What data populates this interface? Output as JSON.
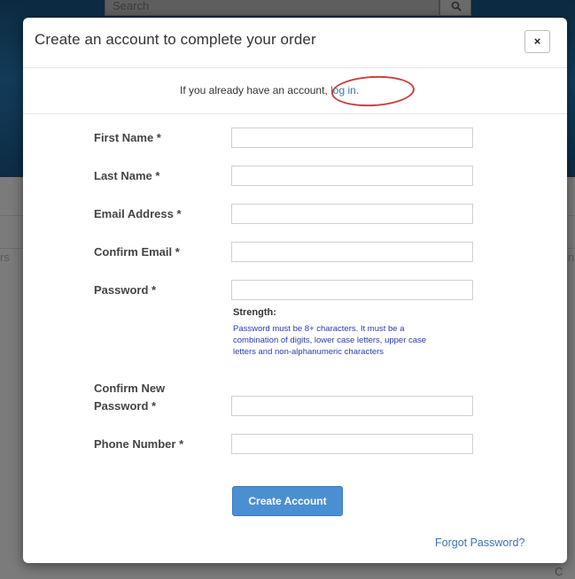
{
  "background": {
    "search_placeholder": "Search",
    "left_fragment": "rs",
    "right_fragment": "n",
    "bottom_fragment": "C"
  },
  "modal": {
    "title": "Create an account to complete your order",
    "close_symbol": "×",
    "login_prompt": "If you already have an account,",
    "login_link": "log in."
  },
  "form": {
    "fields": [
      {
        "label": "First Name *",
        "value": ""
      },
      {
        "label": "Last Name *",
        "value": ""
      },
      {
        "label": "Email Address *",
        "value": ""
      },
      {
        "label": "Confirm Email *",
        "value": ""
      },
      {
        "label": "Password *",
        "value": ""
      },
      {
        "label": "Confirm New",
        "label2": "Password *",
        "value": ""
      },
      {
        "label": "Phone Number *",
        "value": ""
      }
    ],
    "strength_label": "Strength:",
    "password_help": "Password must be 8+ characters. It must be a combination of digits, lower case letters, upper case letters and non-alphanumeric characters",
    "submit_label": "Create Account",
    "forgot_label": "Forgot Password?"
  },
  "colors": {
    "accent": "#4a8fd2",
    "link": "#3a74b8",
    "help_text": "#2a3bb0",
    "annotation": "#c9423f"
  }
}
